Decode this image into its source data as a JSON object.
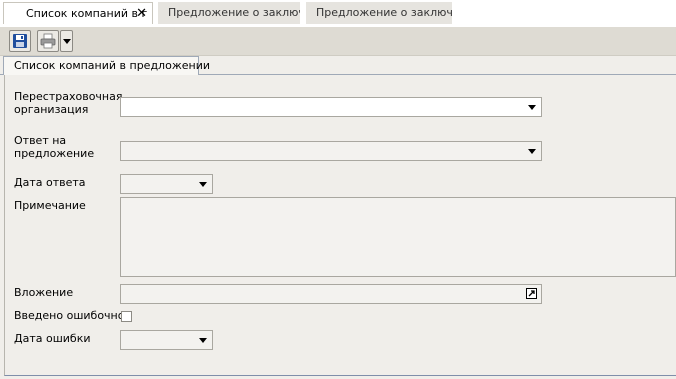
{
  "tabs": [
    {
      "label": "Список компаний в г",
      "active": true
    },
    {
      "label": "Предложение о заключ",
      "active": false
    },
    {
      "label": "Предложение о заключ",
      "active": false
    }
  ],
  "tab_close_glyph": "✕",
  "toolbar": {
    "icons": [
      "save-icon",
      "print-icon",
      "dropdown-arrow-icon"
    ]
  },
  "form_tab": {
    "label": "Список компаний в предложении"
  },
  "form": {
    "reinsurer_label": "Перестраховочная организация",
    "reinsurer_value": "",
    "response_label": "Ответ на предложение",
    "response_value": "",
    "response_date_label": "Дата ответа",
    "response_date_value": "",
    "note_label": "Примечание",
    "note_value": "",
    "attachment_label": "Вложение",
    "attachment_value": "",
    "entered_erroneously_label": "Введено ошибочно",
    "entered_erroneously_checked": false,
    "error_date_label": "Дата ошибки",
    "error_date_value": ""
  },
  "colors": {
    "accent_save": "#1f4e9e",
    "panel_border": "#7f8eaa"
  }
}
